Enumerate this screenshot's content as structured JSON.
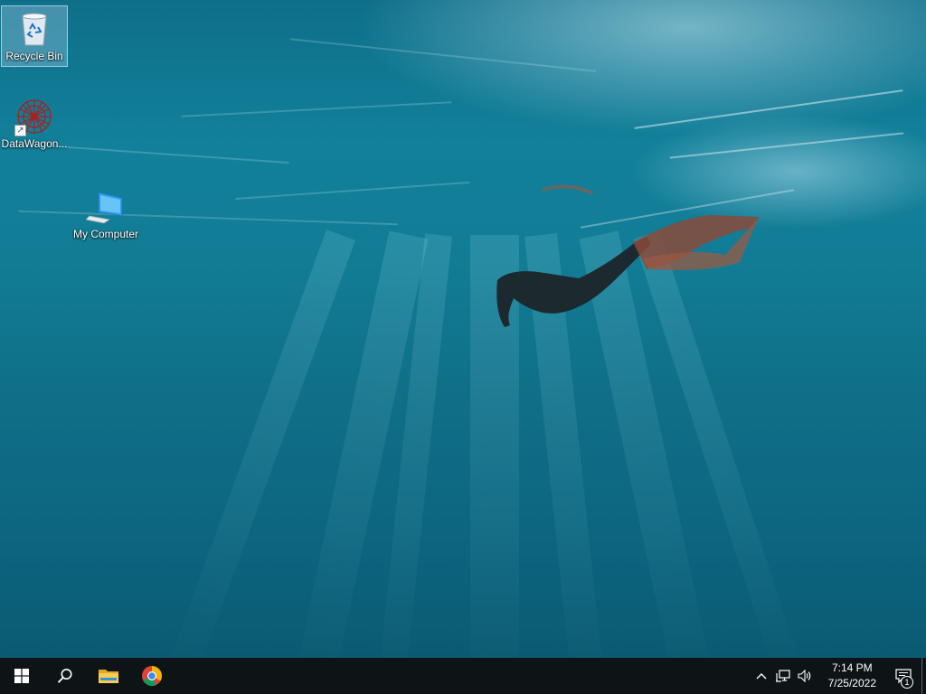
{
  "desktop": {
    "icons": [
      {
        "label": "Recycle Bin",
        "icon": "recycle-bin-icon",
        "selected": true
      },
      {
        "label": "DataWagon...",
        "icon": "datawagon-icon",
        "shortcut": true
      },
      {
        "label": "My Computer",
        "icon": "computer-icon"
      }
    ]
  },
  "taskbar": {
    "start": "windows-start-icon",
    "search": "search-icon",
    "pinned": [
      {
        "name": "File Explorer",
        "icon": "folder-icon"
      },
      {
        "name": "Google Chrome",
        "icon": "chrome-icon"
      }
    ],
    "tray": {
      "icons": [
        "chevron-up-icon",
        "network-icon",
        "volume-icon"
      ],
      "time": "7:14 PM",
      "date": "7/25/2022",
      "notification_count": "1"
    }
  }
}
